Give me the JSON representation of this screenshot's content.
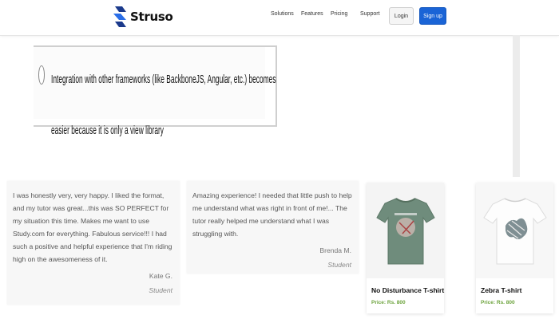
{
  "header": {
    "brand": "Struso",
    "nav": [
      "Solutions",
      "Features",
      "Pricing",
      "Support"
    ],
    "login_label": "Login",
    "signup_label": "Sign up",
    "accent_color": "#1a64d6"
  },
  "quiz": {
    "option_text": "Integration with other frameworks (like BackboneJS, Angular, etc.) becomes easier because it is only a view library"
  },
  "testimonials": [
    {
      "quote": "I was honestly very, very happy. I liked the format, and my tutor was great...this was SO PERFECT for my situation this time. Makes me want to use Study.com for everything. Fabulous service!!! I had such a positive and helpful experience that I'm riding high on the awesomeness of it.",
      "author": "Kate G.",
      "role": "Student"
    },
    {
      "quote": "Amazing experience! I needed that little push to help me understand what was right in front of me!... The tutor really helped me understand what I was struggling with.",
      "author": "Brenda M.",
      "role": "Student"
    }
  ],
  "products": [
    {
      "name": "No Disturbance T-shirt",
      "price": "Price: Rs. 800",
      "shirt_color": "#6f8c7c"
    },
    {
      "name": "Zebra T-shirt",
      "price": "Price: Rs. 800",
      "shirt_color": "#f8f8f8"
    }
  ]
}
